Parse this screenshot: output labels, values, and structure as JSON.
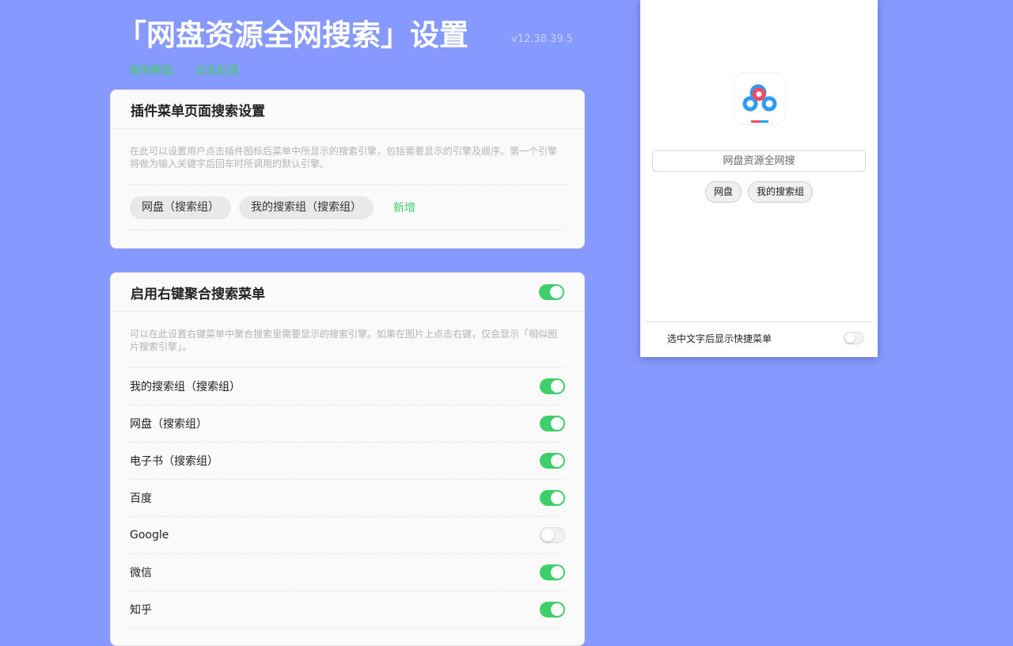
{
  "header": {
    "title": "「网盘资源全网搜索」设置",
    "version": "v12.38.39.5",
    "links": [
      "使用帮助",
      "交流反馈"
    ]
  },
  "menu_search_card": {
    "title": "插件菜单页面搜索设置",
    "description": "在此可以设置用户点击插件图标后菜单中所显示的搜索引擎，包括需要显示的引擎及顺序。第一个引擎将做为输入关键字后回车时所调用的默认引擎。",
    "chips": [
      "网盘（搜索组）",
      "我的搜索组（搜索组）"
    ],
    "add_label": "新增"
  },
  "context_menu_card": {
    "title": "启用右键聚合搜索菜单",
    "enabled": true,
    "description": "可以在此设置右键菜单中聚合搜索里需要显示的搜索引擎。如果在图片上点击右键，仅会显示「相似图片搜索引擎」。",
    "items": [
      {
        "label": "我的搜索组（搜索组）",
        "on": true
      },
      {
        "label": "网盘（搜索组）",
        "on": true
      },
      {
        "label": "电子书（搜索组）",
        "on": true
      },
      {
        "label": "百度",
        "on": true
      },
      {
        "label": "Google",
        "on": false
      },
      {
        "label": "微信",
        "on": true
      },
      {
        "label": "知乎",
        "on": true
      }
    ]
  },
  "popup": {
    "search_value": "网盘资源全网搜",
    "chips": [
      "网盘",
      "我的搜索组"
    ],
    "quick_menu_label": "选中文字后显示快捷菜单",
    "quick_menu_on": false
  },
  "colors": {
    "background": "#8599fe",
    "accent": "#3fcf6a"
  }
}
